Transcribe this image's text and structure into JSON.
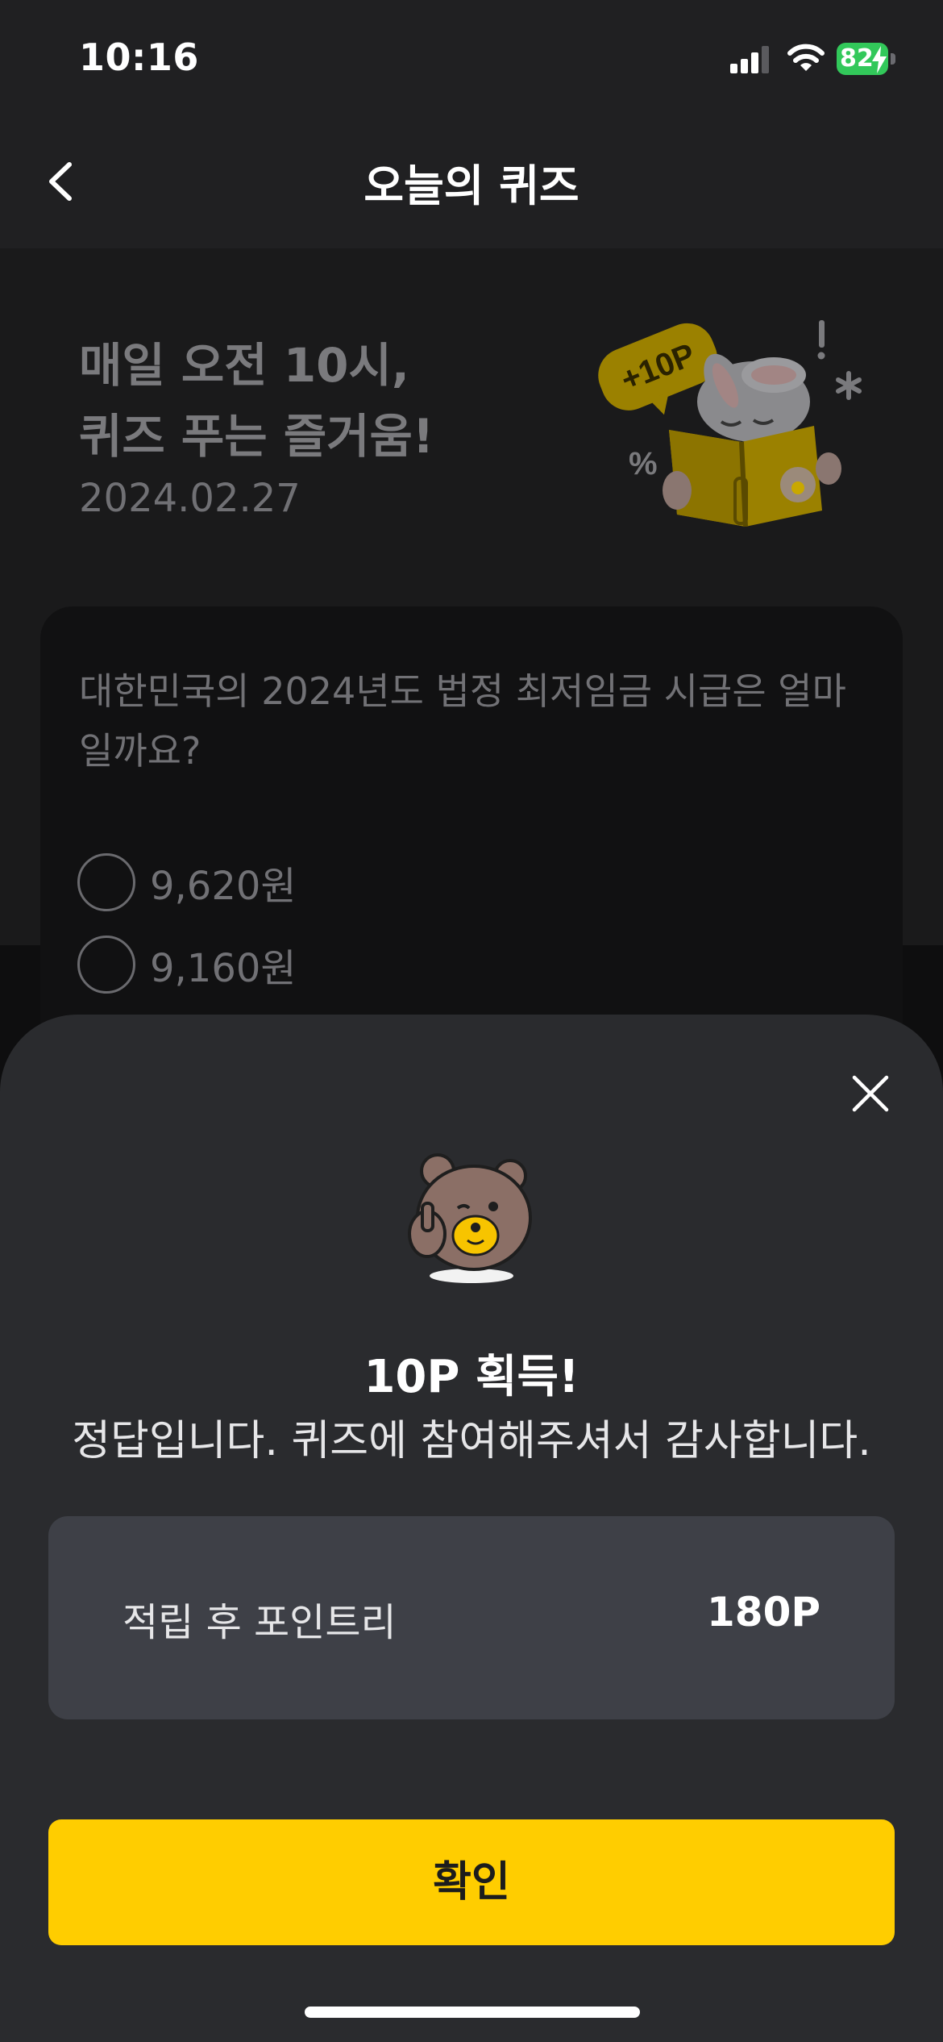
{
  "status_bar": {
    "time": "10:16",
    "battery_percent": "82",
    "battery_color": "#32c85a",
    "icons": [
      "cellular-signal-icon",
      "wifi-icon",
      "battery-charging-icon"
    ]
  },
  "header": {
    "title": "오늘의 퀴즈",
    "back_icon": "chevron-left-icon"
  },
  "hero": {
    "line1": "매일 오전 10시,",
    "line2": "퀴즈 푸는 즐거움!",
    "date": "2024.02.27",
    "illustration": {
      "badge_text": "+10P",
      "description_icon": "rabbit-reading-book-icon"
    }
  },
  "quiz": {
    "question": "대한민국의 2024년도 법정 최저임금 시급은 얼마일까요?",
    "options": [
      {
        "label": "9,620원"
      },
      {
        "label": "9,160원"
      }
    ]
  },
  "sheet": {
    "close_icon": "close-icon",
    "mascot_icon": "bear-thumbs-up-icon",
    "reward_title": "10P 획득!",
    "reward_message": "정답입니다. 퀴즈에 참여해주셔서 감사합니다.",
    "points": {
      "label": "적립 후 포인트리",
      "value": "180P"
    },
    "confirm_label": "확인",
    "accent_color": "#ffcd00"
  }
}
